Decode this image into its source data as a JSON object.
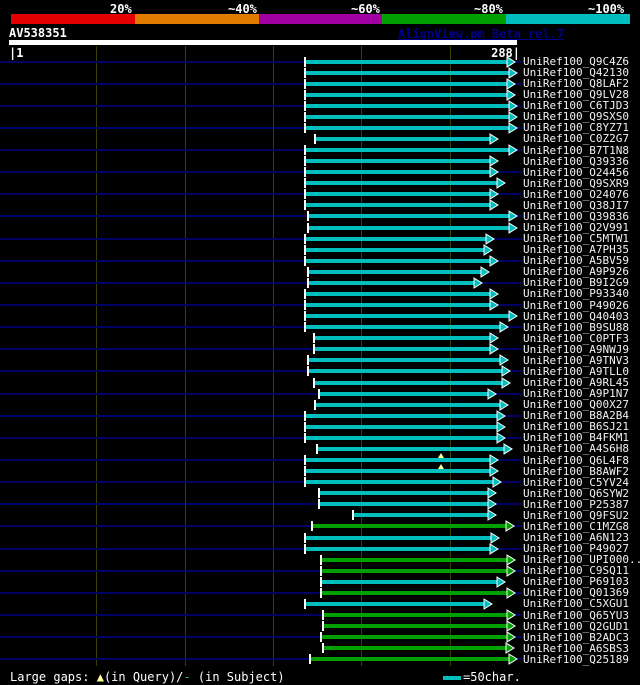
{
  "header": {
    "query_name": "AV538351",
    "watermark": "AlignView.pm Beta rel.7",
    "identity_scale": {
      "bins": [
        {
          "label": "20%",
          "color": "#e40000"
        },
        {
          "label": "~40%",
          "color": "#e17c00"
        },
        {
          "label": "~60%",
          "color": "#a300a3"
        },
        {
          "label": "~80%",
          "color": "#00a000"
        },
        {
          "label": "~100%",
          "color": "#00bebe"
        }
      ]
    }
  },
  "ruler": {
    "start_label": "|1",
    "end_label": "288|"
  },
  "legend": {
    "prefix": "Large gaps: ",
    "query_symbol": "▲",
    "query_text": "(in Query)/",
    "subject_symbol": "-",
    "subject_text": " (in Subject)",
    "scale_text": "=50char."
  },
  "chart_data": {
    "type": "bar",
    "subtype": "sequence-alignment-overview",
    "title": "AV538351",
    "x_axis": {
      "min": 1,
      "max": 288,
      "ticks": [
        50,
        100,
        150,
        200,
        250
      ]
    },
    "legend_note": "bar color encodes % identity; cyan ~100%, green ~80%",
    "colors": {
      "cyan": "#00bebe",
      "green": "#00a000",
      "row_guideline": "#000066",
      "gridline": "#3f3f00",
      "gap_marker": "#ffff99",
      "tick_white": "#ffffff"
    },
    "rows": [
      {
        "label": "UniRef100_Q9C4Z6",
        "color": "cyan",
        "from": 168,
        "to": 287
      },
      {
        "label": "UniRef100_Q42130",
        "color": "cyan",
        "from": 168,
        "to": 288
      },
      {
        "label": "UniRef100_Q8LAF2",
        "color": "cyan",
        "from": 168,
        "to": 287
      },
      {
        "label": "UniRef100_Q9LV28",
        "color": "cyan",
        "from": 168,
        "to": 287
      },
      {
        "label": "UniRef100_C6TJD3",
        "color": "cyan",
        "from": 168,
        "to": 288
      },
      {
        "label": "UniRef100_Q9SXS0",
        "color": "cyan",
        "from": 168,
        "to": 288
      },
      {
        "label": "UniRef100_C8YZ71",
        "color": "cyan",
        "from": 168,
        "to": 288
      },
      {
        "label": "UniRef100_C0Z2G7",
        "color": "cyan",
        "from": 174,
        "to": 277
      },
      {
        "label": "UniRef100_B7T1N8",
        "color": "cyan",
        "from": 168,
        "to": 288
      },
      {
        "label": "UniRef100_Q39336",
        "color": "cyan",
        "from": 168,
        "to": 277
      },
      {
        "label": "UniRef100_O24456",
        "color": "cyan",
        "from": 168,
        "to": 277
      },
      {
        "label": "UniRef100_Q9SXR9",
        "color": "cyan",
        "from": 168,
        "to": 281
      },
      {
        "label": "UniRef100_O24076",
        "color": "cyan",
        "from": 168,
        "to": 277
      },
      {
        "label": "UniRef100_Q38JI7",
        "color": "cyan",
        "from": 168,
        "to": 277
      },
      {
        "label": "UniRef100_Q39836",
        "color": "cyan",
        "from": 170,
        "to": 288
      },
      {
        "label": "UniRef100_Q2V991",
        "color": "cyan",
        "from": 170,
        "to": 288
      },
      {
        "label": "UniRef100_C5MTW1",
        "color": "cyan",
        "from": 168,
        "to": 275
      },
      {
        "label": "UniRef100_A7PH35",
        "color": "cyan",
        "from": 168,
        "to": 274
      },
      {
        "label": "UniRef100_A5BV59",
        "color": "cyan",
        "from": 168,
        "to": 277
      },
      {
        "label": "UniRef100_A9P926",
        "color": "cyan",
        "from": 170,
        "to": 272
      },
      {
        "label": "UniRef100_B9I2G9",
        "color": "cyan",
        "from": 170,
        "to": 268
      },
      {
        "label": "UniRef100_P93340",
        "color": "cyan",
        "from": 168,
        "to": 277
      },
      {
        "label": "UniRef100_P49026",
        "color": "cyan",
        "from": 168,
        "to": 277
      },
      {
        "label": "UniRef100_Q40403",
        "color": "cyan",
        "from": 168,
        "to": 288
      },
      {
        "label": "UniRef100_B9SU88",
        "color": "cyan",
        "from": 168,
        "to": 283
      },
      {
        "label": "UniRef100_C0PTF3",
        "color": "cyan",
        "from": 173,
        "to": 277
      },
      {
        "label": "UniRef100_A9NWJ9",
        "color": "cyan",
        "from": 173,
        "to": 277
      },
      {
        "label": "UniRef100_A9TNV3",
        "color": "cyan",
        "from": 170,
        "to": 283
      },
      {
        "label": "UniRef100_A9TLL0",
        "color": "cyan",
        "from": 170,
        "to": 284
      },
      {
        "label": "UniRef100_A9RL45",
        "color": "cyan",
        "from": 173,
        "to": 284
      },
      {
        "label": "UniRef100_A9P1N7",
        "color": "cyan",
        "from": 176,
        "to": 276
      },
      {
        "label": "UniRef100_Q00X27",
        "color": "cyan",
        "from": 174,
        "to": 283
      },
      {
        "label": "UniRef100_B8A2B4",
        "color": "cyan",
        "from": 168,
        "to": 281
      },
      {
        "label": "UniRef100_B6SJ21",
        "color": "cyan",
        "from": 168,
        "to": 281
      },
      {
        "label": "UniRef100_B4FKM1",
        "color": "cyan",
        "from": 168,
        "to": 281
      },
      {
        "label": "UniRef100_A4S6H8",
        "color": "cyan",
        "from": 175,
        "to": 285
      },
      {
        "label": "UniRef100_Q6L4F8",
        "color": "cyan",
        "from": 168,
        "to": 277,
        "query_gap_markers": [
          245
        ]
      },
      {
        "label": "UniRef100_B8AWF2",
        "color": "cyan",
        "from": 168,
        "to": 277,
        "query_gap_markers": [
          245
        ]
      },
      {
        "label": "UniRef100_C5YV24",
        "color": "cyan",
        "from": 168,
        "to": 279
      },
      {
        "label": "UniRef100_Q6SYW2",
        "color": "cyan",
        "from": 176,
        "to": 276
      },
      {
        "label": "UniRef100_P25387",
        "color": "cyan",
        "from": 176,
        "to": 276
      },
      {
        "label": "UniRef100_Q9FSU2",
        "color": "cyan",
        "from": 195,
        "to": 276
      },
      {
        "label": "UniRef100_C1MZG8",
        "color": "green",
        "from": 172,
        "to": 286
      },
      {
        "label": "UniRef100_A6N123",
        "color": "cyan",
        "from": 168,
        "to": 278
      },
      {
        "label": "UniRef100_P49027",
        "color": "cyan",
        "from": 168,
        "to": 277
      },
      {
        "label": "UniRef100_UPI000..",
        "color": "green",
        "from": 177,
        "to": 287
      },
      {
        "label": "UniRef100_C9SQ11",
        "color": "green",
        "from": 177,
        "to": 287
      },
      {
        "label": "UniRef100_P69103",
        "color": "cyan",
        "from": 177,
        "to": 281
      },
      {
        "label": "UniRef100_Q01369",
        "color": "green",
        "from": 177,
        "to": 287
      },
      {
        "label": "UniRef100_C5XGU1",
        "color": "cyan",
        "from": 168,
        "to": 274
      },
      {
        "label": "UniRef100_Q65YU3",
        "color": "green",
        "from": 178,
        "to": 287
      },
      {
        "label": "UniRef100_Q2GUD1",
        "color": "green",
        "from": 178,
        "to": 287
      },
      {
        "label": "UniRef100_B2ADC3",
        "color": "green",
        "from": 177,
        "to": 287
      },
      {
        "label": "UniRef100_A6SBS3",
        "color": "green",
        "from": 178,
        "to": 286
      },
      {
        "label": "UniRef100_Q25189",
        "color": "green",
        "from": 171,
        "to": 288
      }
    ]
  }
}
